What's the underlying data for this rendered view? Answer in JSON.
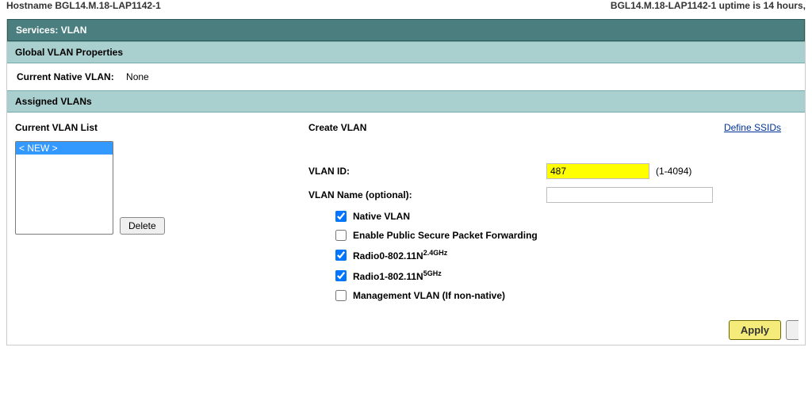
{
  "topbar": {
    "hostname_label": "Hostname",
    "hostname_value": "BGL14.M.18-LAP1142-1",
    "uptime_text": "BGL14.M.18-LAP1142-1 uptime is 14 hours,"
  },
  "headers": {
    "services_vlan": "Services: VLAN",
    "global_vlan_props": "Global VLAN Properties",
    "assigned_vlans": "Assigned VLANs"
  },
  "native_vlan": {
    "label": "Current Native VLAN:",
    "value": "None"
  },
  "left": {
    "title": "Current VLAN List",
    "new_option": "< NEW >",
    "delete_btn": "Delete"
  },
  "mid": {
    "create_title": "Create VLAN",
    "define_ssids": "Define SSIDs",
    "vlan_id_label": "VLAN ID:",
    "vlan_id_value": "487",
    "vlan_id_hint": "(1-4094)",
    "vlan_name_label": "VLAN Name (optional):",
    "vlan_name_value": "",
    "chk_native": "Native VLAN",
    "chk_pspf": "Enable Public Secure Packet Forwarding",
    "chk_r0_a": "Radio0-802.11N",
    "chk_r0_b": "2.4GHz",
    "chk_r1_a": "Radio1-802.11N",
    "chk_r1_b": "5GHz",
    "chk_mgmt": "Management VLAN (If non-native)"
  },
  "footer": {
    "apply": "Apply"
  }
}
